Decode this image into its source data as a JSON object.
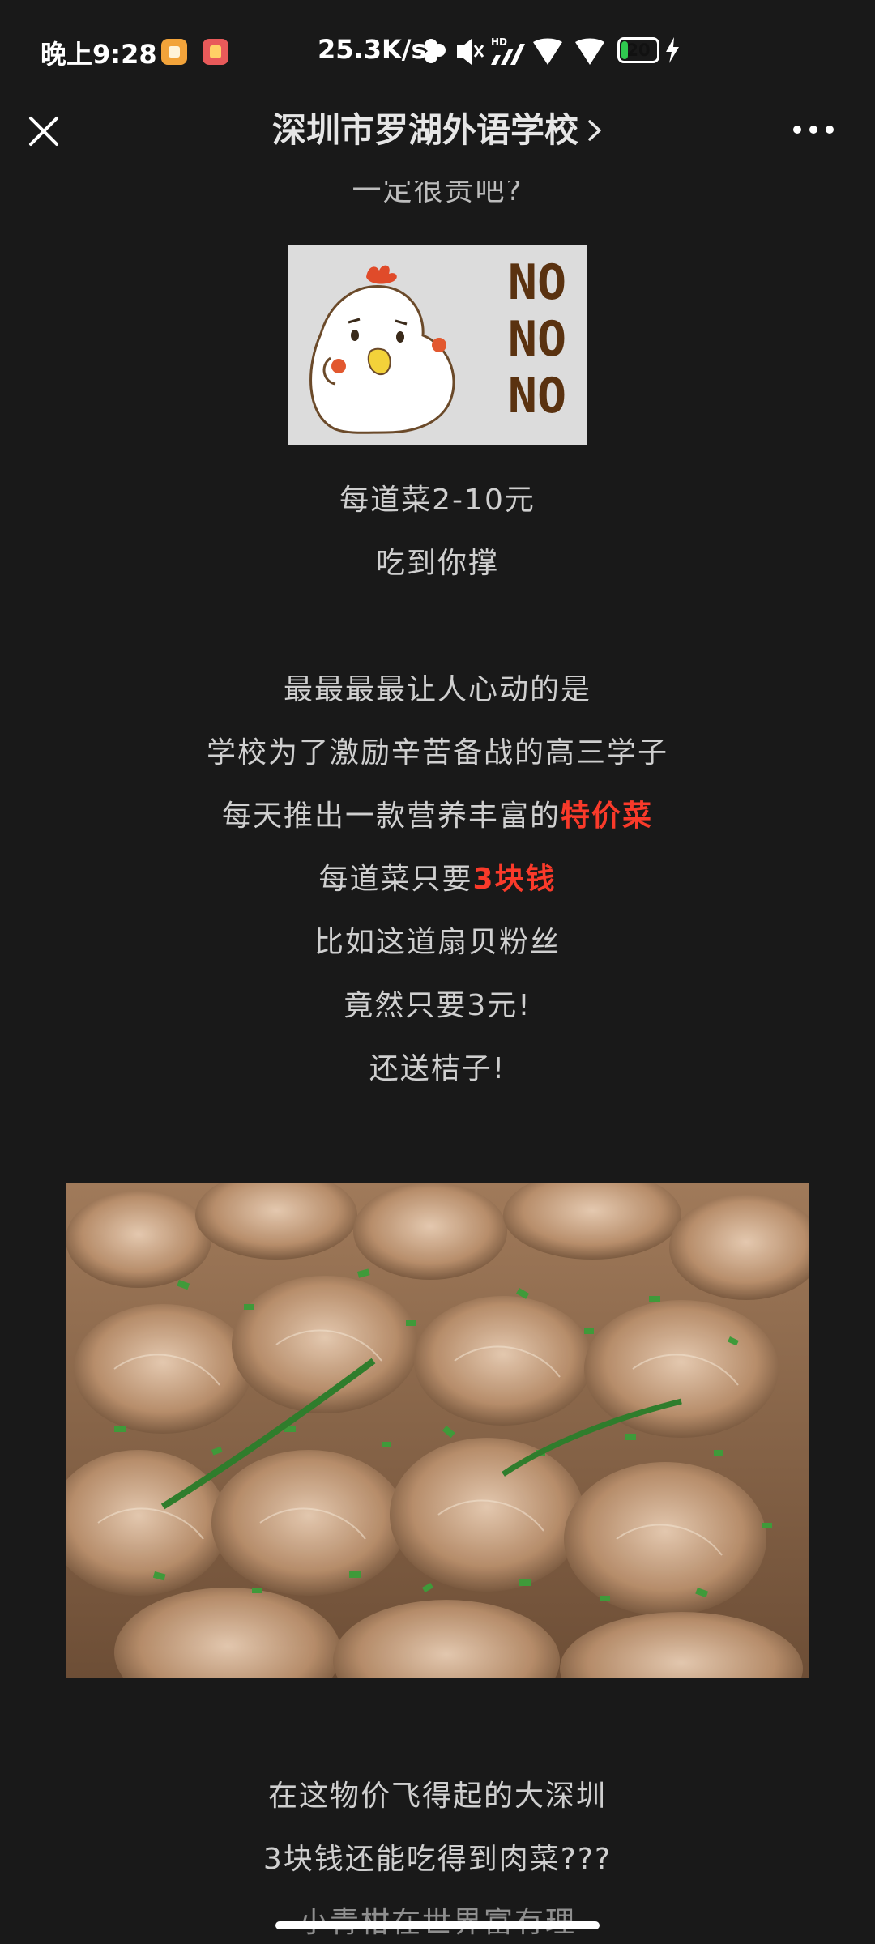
{
  "status_bar": {
    "time": "晚上9:28",
    "net_speed": "25.3K/s",
    "battery_level": "20",
    "battery_fill_fraction": 0.2,
    "battery_color": "#2fc94f",
    "icons": [
      "app-notification-icon",
      "app-notification-icon",
      "bluetooth-icon",
      "mute-icon",
      "hd-signal-icon",
      "signal-icon",
      "wifi-icon",
      "battery-icon",
      "charging-icon"
    ]
  },
  "nav": {
    "title": "深圳市罗湖外语学校",
    "close_icon": "close-icon",
    "more_icon": "more-icon"
  },
  "article": {
    "partial_top_line": "一定很贵吧?",
    "sticker_text": [
      "NO",
      "NO",
      "NO"
    ],
    "lines_block1": [
      "每道菜2-10元",
      "吃到你撑"
    ],
    "lines_block2": {
      "l1": "最最最最让人心动的是",
      "l2": "学校为了激励辛苦备战的高三学子",
      "l3_pre": "每天推出一款营养丰富的",
      "l3_emph": "特价菜",
      "l4_pre": "每道菜只要",
      "l4_emph": "3块钱",
      "l5": "比如这道扇贝粉丝",
      "l6": "竟然只要3元!",
      "l7": "还送桔子!"
    },
    "lines_block3": [
      "在这物价飞得起的大深圳",
      "3块钱还能吃得到肉菜???",
      "小青柑在世界富有理"
    ],
    "accent_color": "#fa3a2a"
  }
}
